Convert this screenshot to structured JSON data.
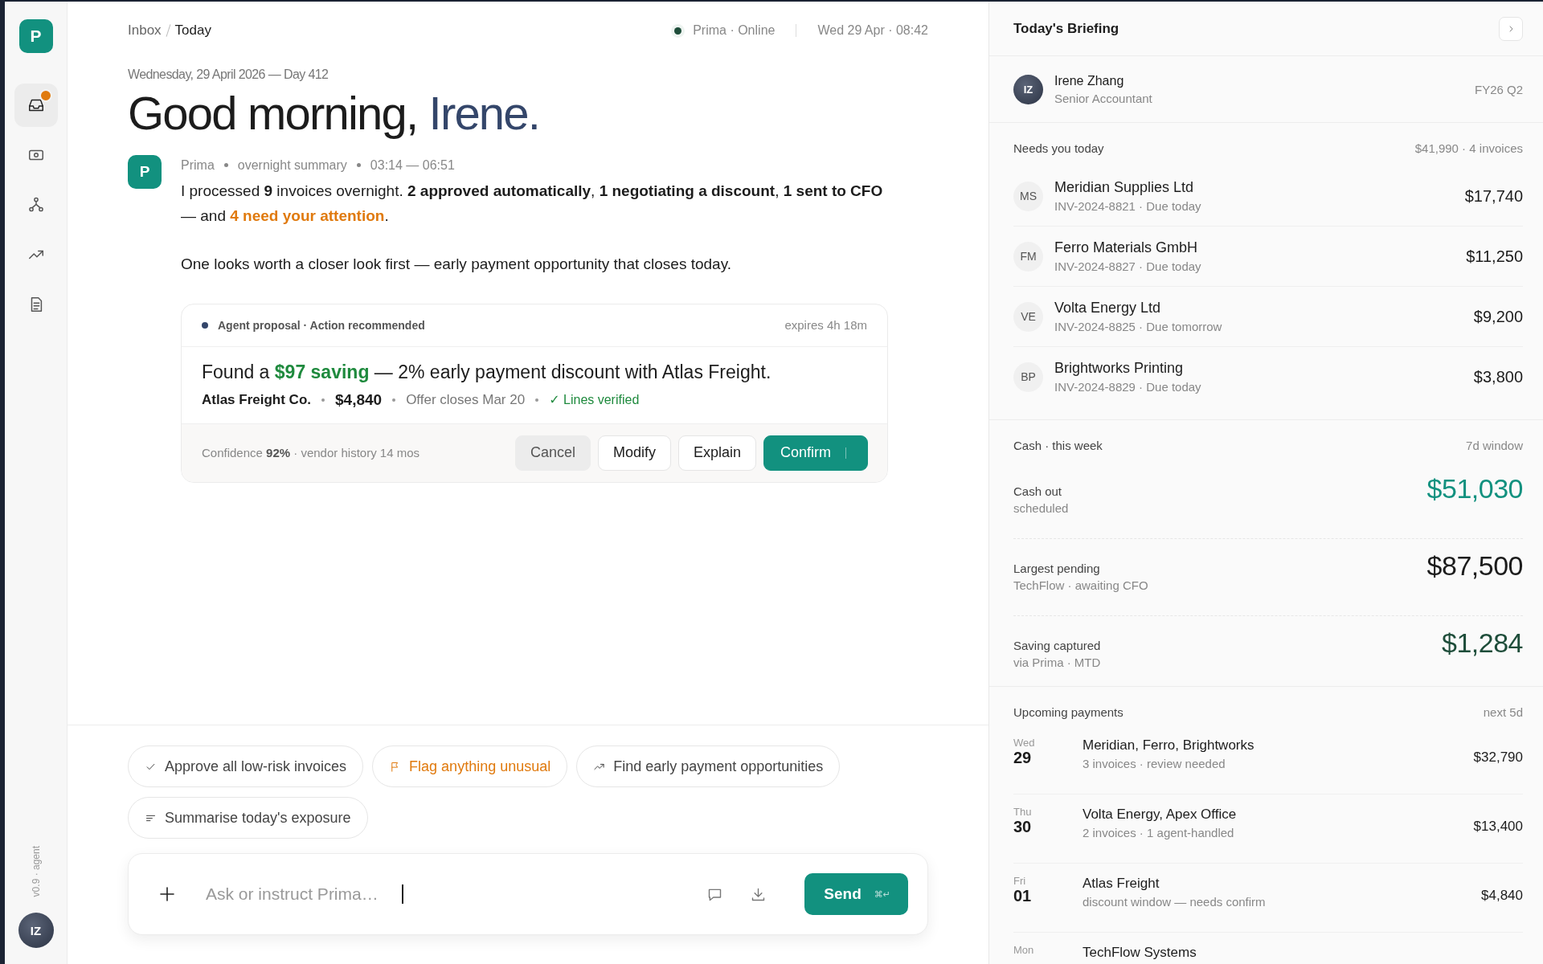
{
  "rail": {
    "logo": "P",
    "nav": [
      {
        "kind": "inbox",
        "selected": true,
        "badge": true
      },
      {
        "kind": "cash",
        "selected": false,
        "badge": false
      },
      {
        "kind": "flow",
        "selected": false,
        "badge": false
      },
      {
        "kind": "trend",
        "selected": false,
        "badge": false
      },
      {
        "kind": "doc",
        "selected": false,
        "badge": false
      }
    ],
    "version": "v0.9 · agent",
    "avatar": "IZ"
  },
  "header": {
    "breadcrumb": [
      {
        "label": "Inbox",
        "current": false
      },
      {
        "label": "Today",
        "current": true
      }
    ],
    "status": "Prima · Online",
    "online": true,
    "datetime": "Wed 29 Apr · 08:42"
  },
  "date_line": "Wednesday, 29 April 2026 — Day 412",
  "greeting": [
    {
      "text": "Good morning, ",
      "kind": "plain"
    },
    {
      "text": "Irene.",
      "kind": "accent"
    }
  ],
  "message": {
    "avatar": "P",
    "meta": [
      "Prima",
      "overnight summary",
      "03:14 — 06:51"
    ],
    "paragraphs": [
      [
        {
          "text": "I processed ",
          "kind": "plain"
        },
        {
          "text": "9",
          "kind": "bold"
        },
        {
          "text": " invoices overnight. ",
          "kind": "plain"
        },
        {
          "text": "2 approved automatically",
          "kind": "bold"
        },
        {
          "text": ", ",
          "kind": "plain"
        },
        {
          "text": "1 negotiating a discount",
          "kind": "bold"
        },
        {
          "text": ", ",
          "kind": "plain"
        },
        {
          "text": "1 sent to CFO",
          "kind": "bold"
        },
        {
          "text": " — and ",
          "kind": "plain"
        },
        {
          "text": "4 need your attention",
          "kind": "alert"
        },
        {
          "text": ".",
          "kind": "plain"
        }
      ],
      [
        {
          "text": "One looks worth a closer look first — early payment opportunity that closes today.",
          "kind": "plain"
        }
      ]
    ]
  },
  "proposal": {
    "label": "Agent proposal · Action recommended",
    "expires": "expires 4h 18m",
    "headline": [
      {
        "text": "Found a ",
        "kind": "plain"
      },
      {
        "text": "$97 saving",
        "kind": "positive"
      },
      {
        "text": " — 2% early payment discount with Atlas Freight.",
        "kind": "plain"
      }
    ],
    "details": [
      {
        "text": "Atlas Freight Co.",
        "kind": "vendor"
      },
      {
        "text": "$4,840",
        "kind": "amount"
      },
      {
        "text": "Offer closes Mar 20",
        "kind": "note"
      },
      {
        "text": "✓ Lines verified",
        "kind": "verified"
      }
    ],
    "confidence": [
      {
        "text": "Confidence ",
        "kind": "plain"
      },
      {
        "text": "92%",
        "kind": "bold"
      },
      {
        "text": " · vendor history 14 mos",
        "kind": "plain"
      }
    ],
    "actions": [
      {
        "label": "Cancel",
        "kind": "muted"
      },
      {
        "label": "Modify",
        "kind": "outline"
      },
      {
        "label": "Explain",
        "kind": "outline"
      },
      {
        "label": "Confirm",
        "kind": "primary"
      }
    ]
  },
  "suggestions": [
    {
      "kind": "check",
      "label": "Approve all low-risk invoices",
      "alert": false
    },
    {
      "kind": "flag",
      "label": "Flag anything unusual",
      "alert": true
    },
    {
      "kind": "trend",
      "label": "Find early payment opportunities",
      "alert": false
    },
    {
      "kind": "lines",
      "label": "Summarise today's exposure",
      "alert": false
    }
  ],
  "composer": {
    "placeholder": "Ask or instruct Prima…",
    "send": "Send",
    "shortcut": "⌘↵"
  },
  "briefing": {
    "title": "Today's Briefing",
    "user": {
      "initials": "IZ",
      "name": "Irene Zhang",
      "role": "Senior Accountant",
      "period": "FY26 Q2"
    },
    "needs": {
      "title": "Needs you today",
      "summary": "$41,990 · 4 invoices",
      "items": [
        {
          "initials": "MS",
          "vendor": "Meridian Supplies Ltd",
          "detail": "INV-2024-8821 · Due today",
          "amount": "$17,740"
        },
        {
          "initials": "FM",
          "vendor": "Ferro Materials GmbH",
          "detail": "INV-2024-8827 · Due today",
          "amount": "$11,250"
        },
        {
          "initials": "VE",
          "vendor": "Volta Energy Ltd",
          "detail": "INV-2024-8825 · Due tomorrow",
          "amount": "$9,200"
        },
        {
          "initials": "BP",
          "vendor": "Brightworks Printing",
          "detail": "INV-2024-8829 · Due today",
          "amount": "$3,800"
        }
      ]
    },
    "cash": {
      "title": "Cash · this week",
      "window": "7d window",
      "metrics": [
        {
          "label": "Cash out",
          "note": "scheduled",
          "value": "$51,030",
          "color": "#12917f"
        },
        {
          "label": "Largest pending",
          "note": "TechFlow · awaiting CFO",
          "value": "$87,500",
          "color": "#1c1c1c"
        },
        {
          "label": "Saving captured",
          "note": "via Prima · MTD",
          "value": "$1,284",
          "color": "#1e4d3a"
        }
      ]
    },
    "upcoming": {
      "title": "Upcoming payments",
      "range": "next 5d",
      "items": [
        {
          "day": "Wed",
          "date": "29",
          "payees": "Meridian, Ferro, Brightworks",
          "detail": "3 invoices · review needed",
          "amount": "$32,790"
        },
        {
          "day": "Thu",
          "date": "30",
          "payees": "Volta Energy, Apex Office",
          "detail": "2 invoices · 1 agent-handled",
          "amount": "$13,400"
        },
        {
          "day": "Fri",
          "date": "01",
          "payees": "Atlas Freight",
          "detail": "discount window — needs confirm",
          "amount": "$4,840"
        },
        {
          "day": "Mon",
          "payees": "TechFlow Systems"
        }
      ]
    }
  }
}
